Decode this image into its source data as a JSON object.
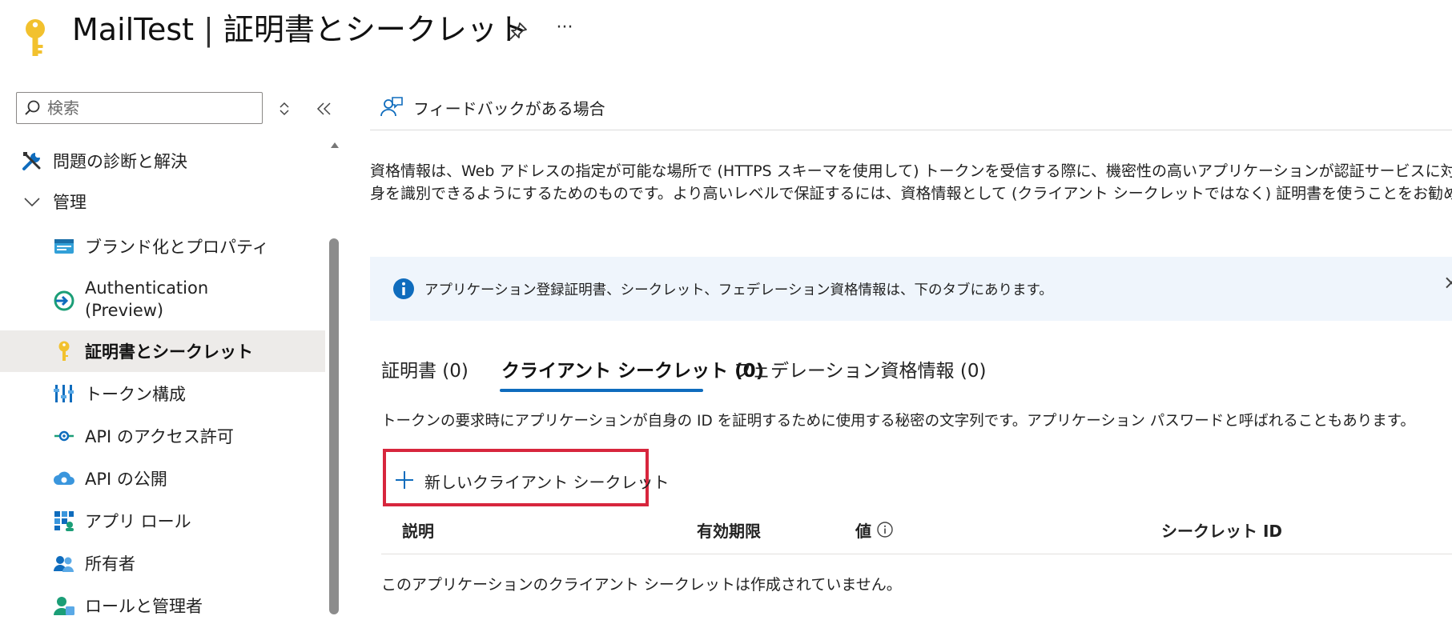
{
  "header": {
    "app_name": "MailTest",
    "separator": "|",
    "page_name": "証明書とシークレット",
    "more_label": "···"
  },
  "sidebar": {
    "search_placeholder": "検索",
    "items": [
      {
        "label": "問題の診断と解決",
        "icon": "wrench-screwdriver-icon"
      },
      {
        "label": "管理",
        "icon": "chevron-down-icon"
      },
      {
        "label": "ブランド化とプロパティ",
        "icon": "branding-icon"
      },
      {
        "label": "Authentication",
        "label2": "(Preview)",
        "icon": "authentication-icon"
      },
      {
        "label": "証明書とシークレット",
        "icon": "key-icon"
      },
      {
        "label": "トークン構成",
        "icon": "token-config-icon"
      },
      {
        "label": "API のアクセス許可",
        "icon": "api-permissions-icon"
      },
      {
        "label": "API の公開",
        "icon": "cloud-api-icon"
      },
      {
        "label": "アプリ ロール",
        "icon": "app-roles-icon"
      },
      {
        "label": "所有者",
        "icon": "owners-icon"
      },
      {
        "label": "ロールと管理者",
        "icon": "roles-admins-icon"
      }
    ],
    "selected_index": 4
  },
  "main": {
    "feedback_label": "フィードバックがある場合",
    "description_line1": "資格情報は、Web アドレスの指定が可能な場所で (HTTPS スキーマを使用して) トークンを受信する際に、機密性の高いアプリケーションが認証サービスに対して",
    "description_line2": "身を識別できるようにするためのものです。より高いレベルで保証するには、資格情報として (クライアント シークレットではなく) 証明書を使うことをお勧めします。",
    "info_bar": {
      "text": "アプリケーション登録証明書、シークレット、フェデレーション資格情報は、下のタブにあります。",
      "close": "×"
    },
    "tabs": [
      {
        "label": "証明書 (0)"
      },
      {
        "label": "クライアント シークレット (0)"
      },
      {
        "label": "フェデレーション資格情報 (0)"
      }
    ],
    "active_tab": 1,
    "tab_description": "トークンの要求時にアプリケーションが自身の ID を証明するために使用する秘密の文字列です。アプリケーション パスワードと呼ばれることもあります。",
    "new_secret_label": "新しいクライアント シークレット",
    "table": {
      "columns": [
        "説明",
        "有効期限",
        "値",
        "シークレット ID"
      ]
    },
    "empty_message": "このアプリケーションのクライアント シークレットは作成されていません。"
  },
  "colors": {
    "accent": "#0f6cbd",
    "highlight_border": "#d7263d",
    "info_bar_bg": "#eff5fc",
    "selected_bg": "#edebe9",
    "key_yellow": "#f2c12e"
  }
}
